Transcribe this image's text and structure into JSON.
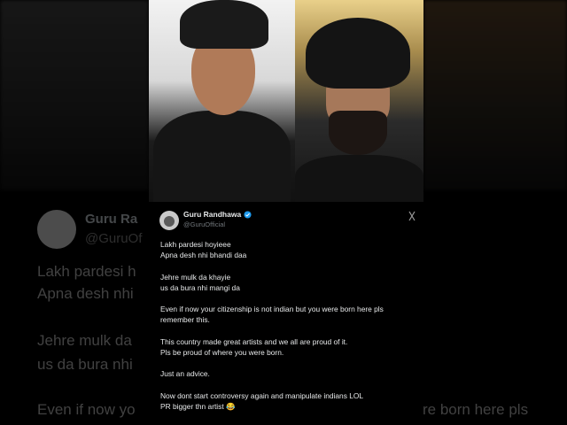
{
  "tweet": {
    "author_name": "Guru Randhawa",
    "handle": "@GuruOfficial",
    "lines": [
      "Lakh pardesi hoyieee",
      "Apna desh nhi bhandi daa",
      "",
      "Jehre mulk da khayie",
      "us da bura nhi mangi da",
      "",
      "Even if now your citizenship is not indian but you were born here pls",
      "remember this.",
      "",
      "This country made great artists and we all are proud of it.",
      "Pls be proud of where you were born.",
      "",
      "Just an advice.",
      "",
      "Now dont start controversy again and manipulate indians LOL",
      "PR bigger thn artist 😂"
    ],
    "verified_color": "#1d9bf0"
  },
  "background": {
    "name": "Guru Ra",
    "handle": "@GuruOf",
    "lines": [
      "Lakh pardesi h",
      "Apna desh nhi",
      "Jehre mulk da",
      "us da bura nhi",
      "Even if now yo",
      "re born here pls"
    ]
  }
}
